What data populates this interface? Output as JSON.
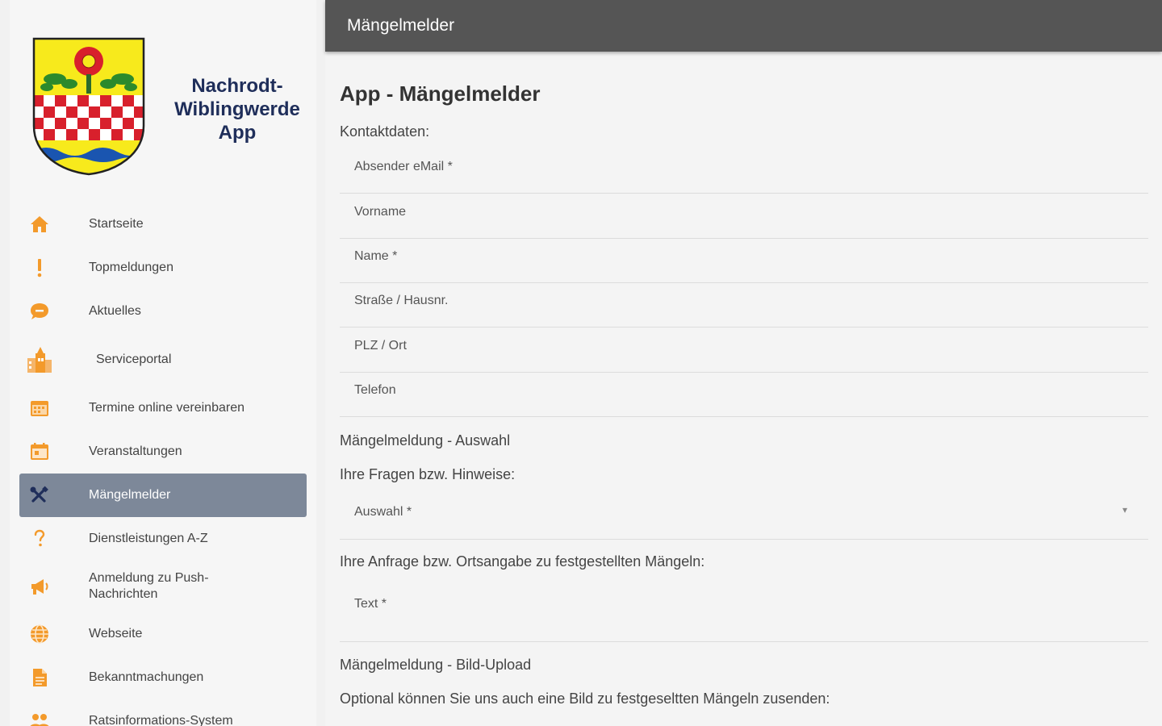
{
  "sidebar": {
    "app_name_line1": "Nachrodt-",
    "app_name_line2": "Wiblingwerde",
    "app_name_line3": "App",
    "items": [
      {
        "label": "Startseite",
        "icon": "home-icon"
      },
      {
        "label": "Topmeldungen",
        "icon": "exclamation-icon"
      },
      {
        "label": "Aktuelles",
        "icon": "chat-icon"
      },
      {
        "label": "Serviceportal",
        "icon": "town-hall-icon"
      },
      {
        "label": "Termine online vereinbaren",
        "icon": "calendar-grid-icon"
      },
      {
        "label": "Veranstaltungen",
        "icon": "calendar-event-icon"
      },
      {
        "label": "Mängelmelder",
        "icon": "tools-icon"
      },
      {
        "label": "Dienstleistungen A-Z",
        "icon": "question-icon"
      },
      {
        "label": "Anmeldung zu Push-Nachrichten",
        "icon": "megaphone-icon"
      },
      {
        "label": "Webseite",
        "icon": "globe-icon"
      },
      {
        "label": "Bekanntmachungen",
        "icon": "document-icon"
      },
      {
        "label": "Ratsinformations-System",
        "icon": "people-icon"
      }
    ]
  },
  "appbar": {
    "title": "Mängelmelder"
  },
  "form": {
    "page_title": "App - Mängelmelder",
    "contact_label": "Kontaktdaten:",
    "fields": {
      "email": "Absender eMail *",
      "firstname": "Vorname",
      "name": "Name *",
      "street": "Straße / Hausnr.",
      "city": "PLZ / Ort",
      "phone": "Telefon"
    },
    "selection_heading": "Mängelmeldung - Auswahl",
    "questions_label": "Ihre Fragen bzw. Hinweise:",
    "select_placeholder": "Auswahl *",
    "request_label": "Ihre Anfrage bzw. Ortsangabe zu festgestellten Mängeln:",
    "text_placeholder": "Text *",
    "upload_heading": "Mängelmeldung - Bild-Upload",
    "upload_hint": "Optional können Sie uns auch eine Bild zu festgeseltten Mängeln zusenden:"
  },
  "colors": {
    "accent_orange": "#f39a2b",
    "active_item_bg": "#7d8899",
    "appbar_bg": "#555555",
    "brand_navy": "#1f2e5a"
  }
}
